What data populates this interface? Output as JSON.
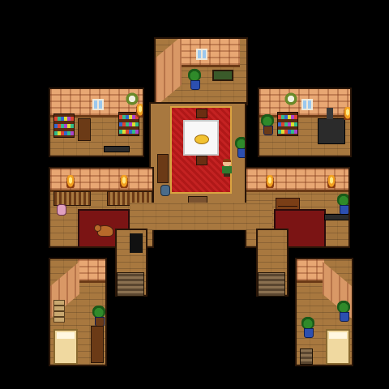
{
  "scene": {
    "background": "#000000",
    "floor_color": "#a8783f",
    "wall_color": "#e8a773",
    "rug_color": "#c42222",
    "dark_rug_color": "#7b1414"
  },
  "rooms": [
    {
      "id": "north-hall"
    },
    {
      "id": "dining-room"
    },
    {
      "id": "library-nw"
    },
    {
      "id": "kitchen-ne"
    },
    {
      "id": "west-wing"
    },
    {
      "id": "east-wing"
    },
    {
      "id": "bedroom-sw"
    },
    {
      "id": "bedroom-se"
    }
  ],
  "objects": {
    "hero": "player-character",
    "pet": "dog",
    "plants": 6,
    "bookshelves": 2,
    "stairways": 2
  },
  "icons": {
    "plant": "potted-plant-icon",
    "window": "window-icon",
    "torch": "wall-torch-icon",
    "stove": "stove-icon",
    "bed": "bed-icon",
    "stairs": "stairs-icon",
    "crate": "crate-icon"
  }
}
